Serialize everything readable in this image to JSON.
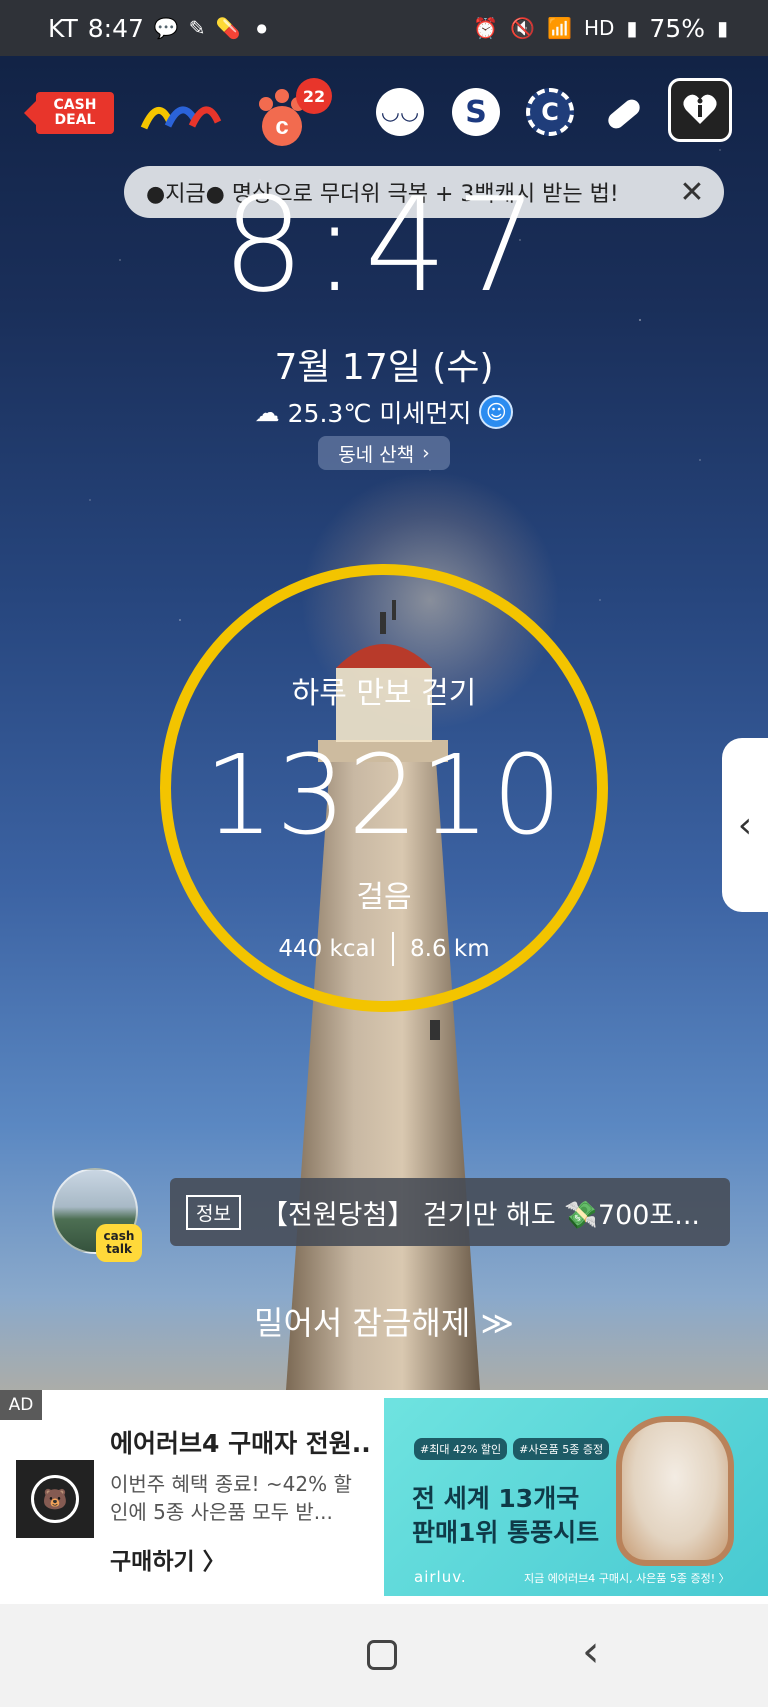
{
  "status_bar": {
    "carrier": "KT",
    "time": "8:47",
    "battery": "75%",
    "left_icons": [
      "kakaotalk-icon",
      "notification-icon",
      "pill-icon"
    ],
    "right_icons": [
      "alarm-icon",
      "mute-icon",
      "wifi-icon",
      "hd-icon",
      "signal-icon",
      "battery-icon"
    ]
  },
  "apps": {
    "cashdeal_line1": "CASH",
    "cashdeal_line2": "DEAL",
    "badge_count": "22",
    "icons": [
      "cashdeal-icon",
      "wave-logo-icon",
      "paw-c-icon",
      "sleepy-eye-icon",
      "s-logo-icon",
      "coin-c-icon",
      "pill-icon",
      "info-heart-icon"
    ]
  },
  "notice": {
    "text": "●지금● 명상으로 무더위 극복 + 3백캐시 받는 법!",
    "close": "✕"
  },
  "clock": {
    "time": "8:47",
    "date": "7월 17일 (수)",
    "weather": "25.3℃ 미세먼지",
    "walk_label": "동네 산책"
  },
  "pedometer": {
    "title": "하루 만보 걷기",
    "steps": "13210",
    "unit": "걸음",
    "kcal": "440 kcal",
    "distance": "8.6 km",
    "ring_color": "#f3c400"
  },
  "cashtalk": {
    "badge_line1": "cash",
    "badge_line2": "talk",
    "tag": "정보",
    "text": "【전원당첨】 걷기만 해도 💸700포..."
  },
  "unlock": {
    "label": "밀어서 잠금해제 ≫"
  },
  "ad": {
    "label": "AD",
    "title": "에어러브4 구매자 전원...",
    "desc": "이번주 혜택 종료! ~42% 할인에 5종 사은품 모두 받...",
    "cta": "구매하기 〉",
    "banner_tag1": "#최대 42% 할인",
    "banner_tag2": "#사은품 5종 증정",
    "banner_line1": "전 세계 13개국",
    "banner_line2": "판매1위 통풍시트",
    "banner_brand": "airluv.",
    "banner_promo": "지금 에어러브4 구매시, 사은품 5종 증정! 〉"
  }
}
